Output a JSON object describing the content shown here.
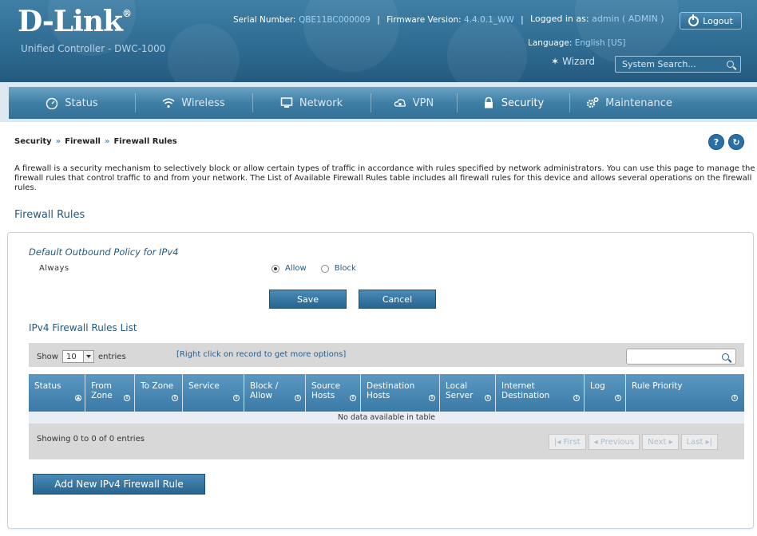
{
  "header": {
    "brand": "D-Link",
    "brand_mark": "®",
    "subtitle": "Unified Controller - DWC-1000",
    "serial_label": "Serial Number:",
    "serial_value": "QBE11BC000009",
    "firmware_label": "Firmware Version:",
    "firmware_value": "4.4.0.1_WW",
    "language_label": "Language:",
    "language_value": "English [US]",
    "logged_in_label": "Logged in as:",
    "logged_in_value": "admin ( ADMIN )",
    "logout_label": "Logout",
    "wizard_label": "Wizard",
    "search_placeholder": "System Search..."
  },
  "nav": {
    "items": [
      {
        "label": "Status",
        "icon": "gauge-icon"
      },
      {
        "label": "Wireless",
        "icon": "wifi-icon"
      },
      {
        "label": "Network",
        "icon": "monitor-icon"
      },
      {
        "label": "VPN",
        "icon": "cloud-lock-icon"
      },
      {
        "label": "Security",
        "icon": "lock-icon"
      },
      {
        "label": "Maintenance",
        "icon": "gears-icon"
      }
    ],
    "active": "Security"
  },
  "breadcrumb": {
    "items": [
      "Security",
      "Firewall",
      "Firewall Rules"
    ],
    "separator": "»"
  },
  "description": "A firewall is a security mechanism to selectively block or allow certain types of traffic in accordance with rules specified by network administrators. You can use this page to manage the firewall rules that control traffic to and from your network. The List of Available Firewall Rules table includes all firewall rules for this device and allows several operations on the firewall rules.",
  "page_title": "Firewall Rules",
  "policy": {
    "title": "Default Outbound Policy for IPv4",
    "row_label": "Always",
    "options": [
      "Allow",
      "Block"
    ],
    "selected": "Allow"
  },
  "buttons": {
    "save": "Save",
    "cancel": "Cancel",
    "add_rule": "Add New IPv4 Firewall Rule"
  },
  "list": {
    "title": "IPv4 Firewall Rules List",
    "show_label": "Show",
    "entries_value": "10",
    "entries_label": "entries",
    "hint": "[Right click on record to get more options]",
    "columns": [
      "Status",
      "From Zone",
      "To Zone",
      "Service",
      "Block / Allow",
      "Source Hosts",
      "Destination Hosts",
      "Local Server",
      "Internet Destination",
      "Log",
      "Rule Priority"
    ],
    "empty_message": "No data available in table",
    "showing": "Showing 0 to 0 of 0 entries",
    "pager": [
      "First",
      "Previous",
      "Next",
      "Last"
    ]
  },
  "colors": {
    "header_blue": "#2f6c93",
    "accent_blue": "#245a80",
    "button_blue": "#3a7aa6"
  }
}
